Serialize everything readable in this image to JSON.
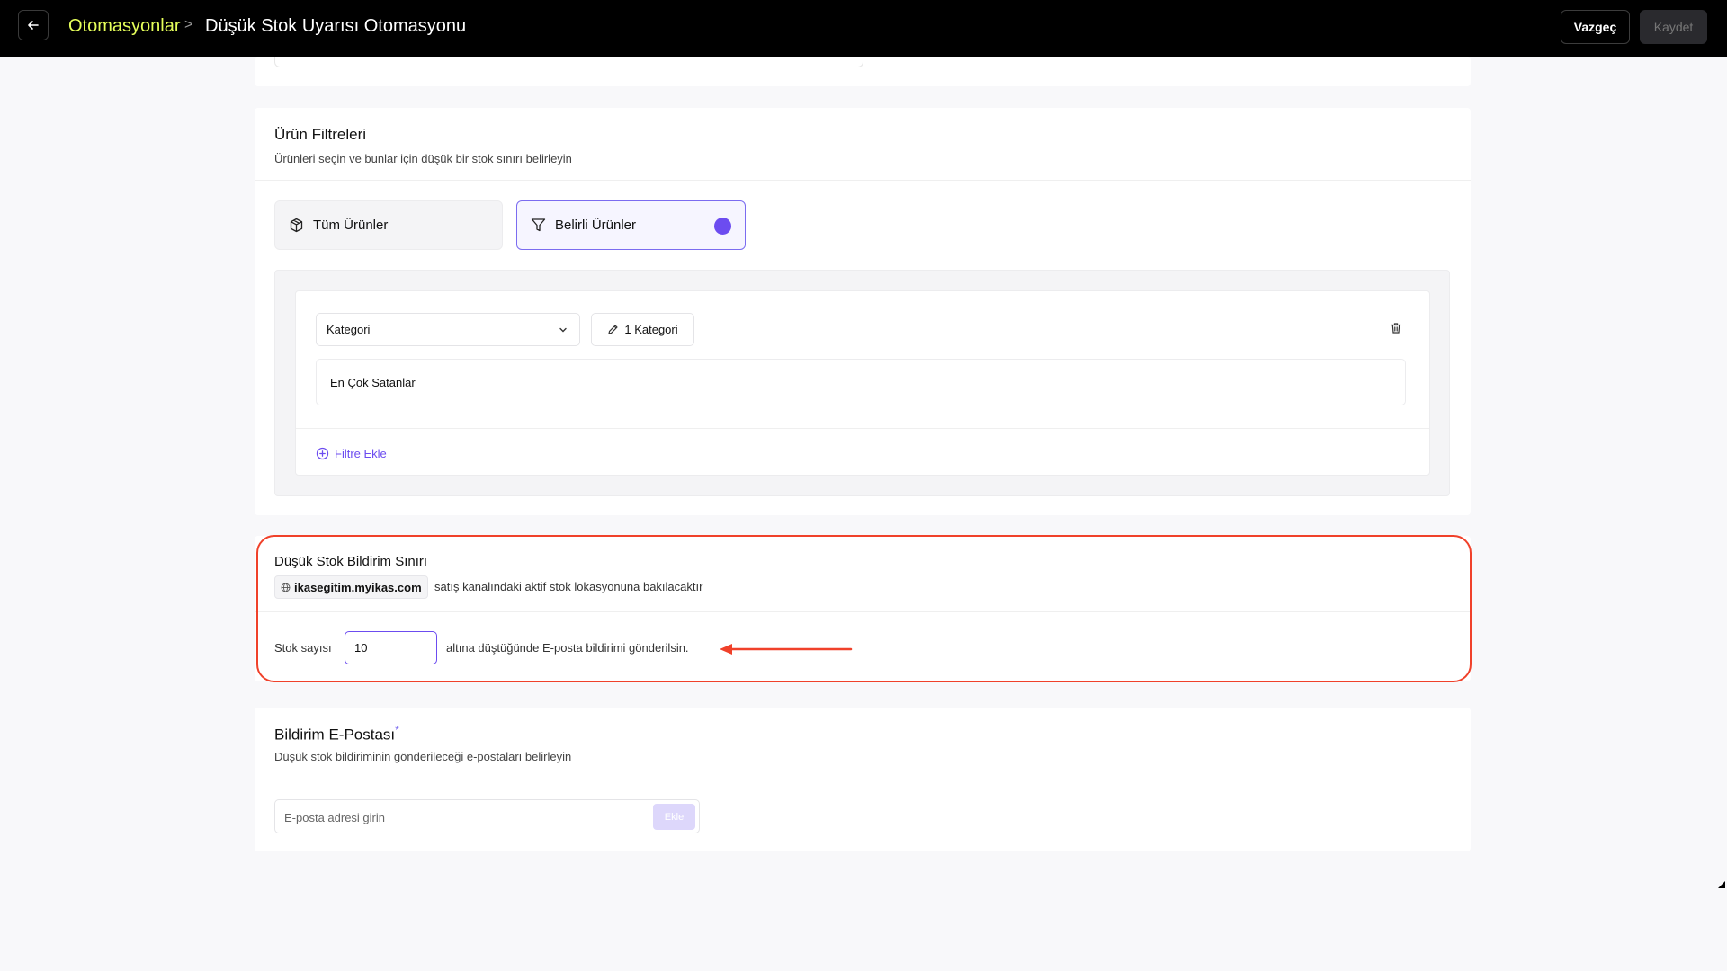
{
  "header": {
    "back_icon": "arrow-left-icon",
    "breadcrumb_root": "Otomasyonlar",
    "breadcrumb_separator": ">",
    "page_title": "Düşük Stok Uyarısı Otomasyonu",
    "cancel_label": "Vazgeç",
    "save_label": "Kaydet",
    "accent_color": "#e6ff5a"
  },
  "product_filters": {
    "title": "Ürün Filtreleri",
    "subtitle": "Ürünleri seçin ve bunlar için düşük bir stok sınırı belirleyin",
    "option_all": "Tüm Ürünler",
    "option_specific": "Belirli Ürünler",
    "selected_option": "Belirli Ürünler",
    "filter": {
      "type_select": "Kategori",
      "count_button": "1 Kategori",
      "selected_items": [
        "En Çok Satanlar"
      ]
    },
    "add_filter_label": "Filtre Ekle"
  },
  "stock_limit": {
    "title": "Düşük Stok Bildirim Sınırı",
    "domain": "ikasegitim.myikas.com",
    "domain_note": "satış kanalındaki aktif stok lokasyonuna bakılacaktır",
    "stock_label": "Stok sayısı",
    "stock_value": "10",
    "stock_suffix": "altına düştüğünde E-posta bildirimi gönderilsin.",
    "highlight_color": "#f0412a"
  },
  "notification_email": {
    "title": "Bildirim E-Postası",
    "required_mark": "*",
    "subtitle": "Düşük stok bildiriminin gönderileceği e-postaları belirleyin",
    "input_placeholder": "E-posta adresi girin",
    "add_label": "Ekle"
  }
}
